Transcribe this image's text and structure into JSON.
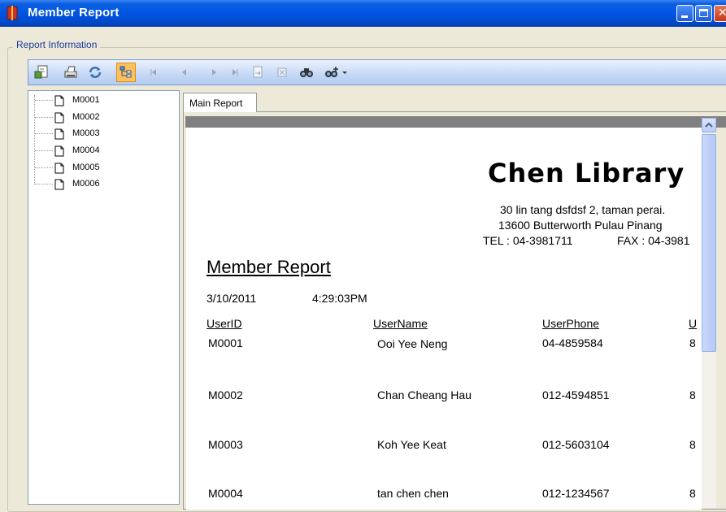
{
  "window": {
    "title": "Member Report"
  },
  "group_label": "Report Information",
  "toolbar": {
    "buttons": [
      "export-icon",
      "print-icon",
      "refresh-icon",
      "toggle-tree-icon",
      "first-page-icon",
      "previous-page-icon",
      "next-page-icon",
      "last-page-icon",
      "go-to-page-icon",
      "stop-icon",
      "find-icon",
      "zoom-icon"
    ]
  },
  "tree": {
    "items": [
      "M0001",
      "M0002",
      "M0003",
      "M0004",
      "M0005",
      "M0006"
    ]
  },
  "tab": {
    "label": "Main Report"
  },
  "report": {
    "library_name": "Chen Library",
    "address1": "30 lin tang dsfdsf 2, taman perai.",
    "address2": "13600 Butterworth Pulau Pinang",
    "tel": "TEL : 04-3981711",
    "fax": "FAX : 04-3981",
    "title": "Member Report",
    "date": "3/10/2011",
    "time": "4:29:03PM",
    "columns": [
      "UserID",
      "UserName",
      "UserPhone",
      "U"
    ],
    "rows": [
      {
        "id": "M0001",
        "name": "Ooi Yee Neng",
        "phone": "04-4859584",
        "extra": "8"
      },
      {
        "id": "M0002",
        "name": "Chan Cheang Hau",
        "phone": "012-4594851",
        "extra": "8"
      },
      {
        "id": "M0003",
        "name": "Koh Yee Keat",
        "phone": "012-5603104",
        "extra": "8"
      },
      {
        "id": "M0004",
        "name": "tan chen chen",
        "phone": "012-1234567",
        "extra": "8"
      }
    ]
  }
}
